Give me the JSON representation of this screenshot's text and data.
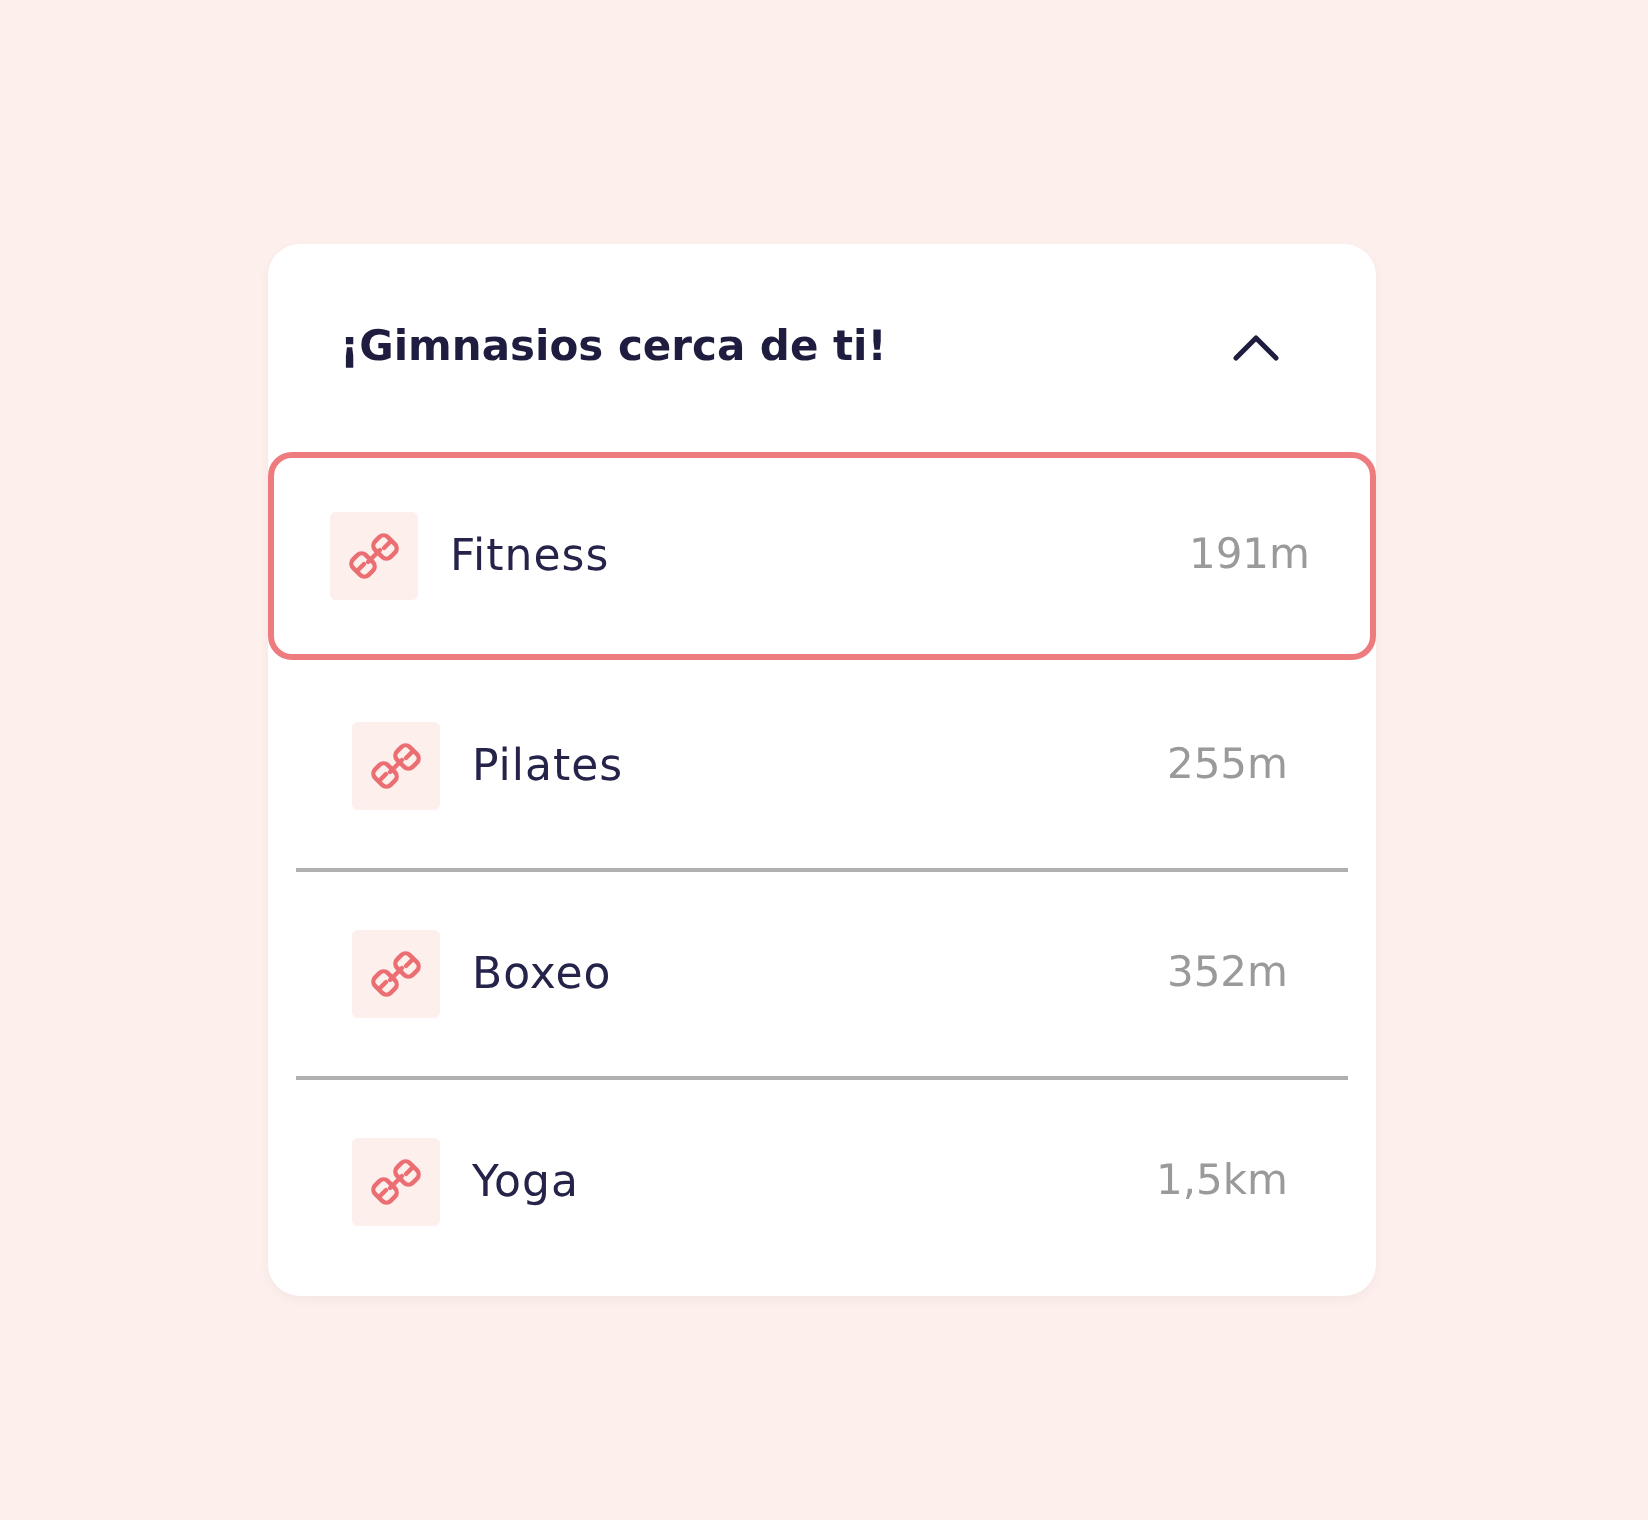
{
  "panel": {
    "title": "¡Gimnasios cerca de ti!",
    "expanded": true
  },
  "gyms": [
    {
      "name": "Fitness",
      "distance": "191m",
      "selected": true
    },
    {
      "name": "Pilates",
      "distance": "255m",
      "selected": false
    },
    {
      "name": "Boxeo",
      "distance": "352m",
      "selected": false
    },
    {
      "name": "Yoga",
      "distance": "1,5km",
      "selected": false
    }
  ]
}
